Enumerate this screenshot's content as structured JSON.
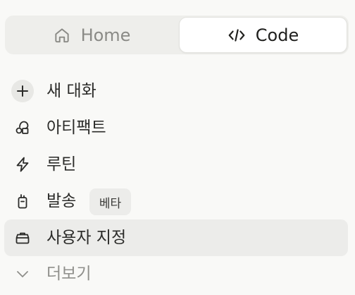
{
  "mode_switch": {
    "home_label": "Home",
    "code_label": "Code",
    "home_icon": "home-icon",
    "code_icon": "code-brackets-icon",
    "selected": "code"
  },
  "menu": {
    "items": [
      {
        "label": "새 대화",
        "icon": "plus-icon"
      },
      {
        "label": "아티팩트",
        "icon": "artifacts-icon"
      },
      {
        "label": "루틴",
        "icon": "lightning-icon"
      },
      {
        "label": "발송",
        "icon": "walkie-talkie-icon",
        "badge": "베타"
      },
      {
        "label": "사용자 지정",
        "icon": "briefcase-icon",
        "selected": true
      },
      {
        "label": "더보기",
        "icon": "chevron-down-icon"
      }
    ]
  },
  "colors": {
    "background": "#f9f9f7",
    "segment_track": "#eeeeeb",
    "selected_row": "#ececea",
    "text": "#2b2b29",
    "muted_text": "#8f8f8b"
  }
}
